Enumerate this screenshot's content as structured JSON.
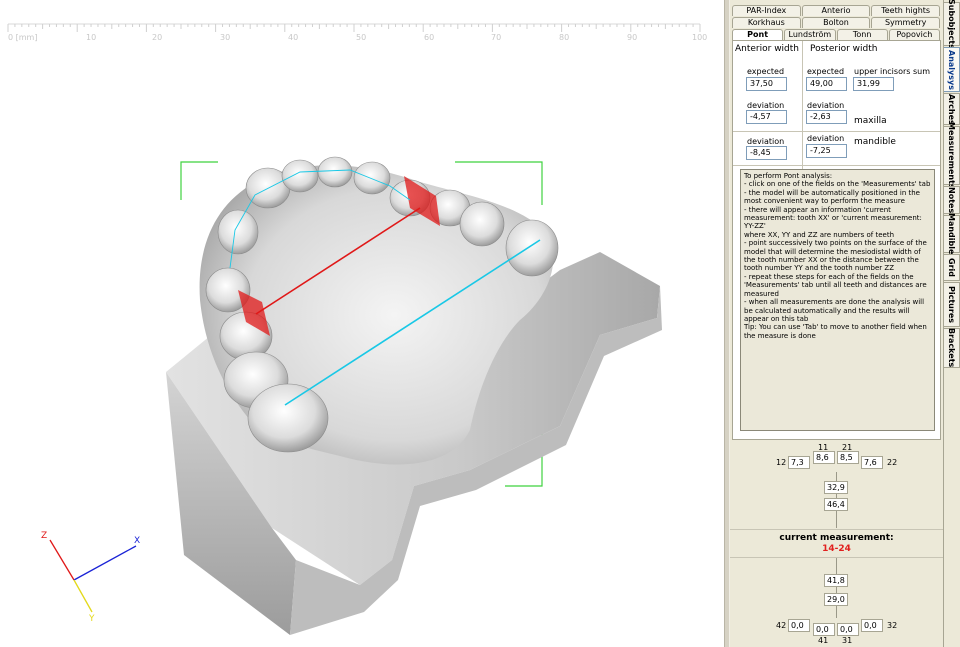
{
  "viewport": {
    "ruler": {
      "labels": [
        "0 [mm]",
        "10",
        "20",
        "30",
        "40",
        "50",
        "60",
        "70",
        "80",
        "90",
        "100"
      ]
    },
    "axes": {
      "z": "Z",
      "x": "X",
      "y": "Y"
    },
    "colors": {
      "measure_red": "#e01818",
      "measure_cyan": "#19c8e6",
      "bracket_green": "#3fd23f"
    }
  },
  "top_tabs": {
    "row1": [
      "PAR-Index",
      "Anterio",
      "Teeth hights"
    ],
    "row2": [
      "Korkhaus",
      "Bolton",
      "Symmetry"
    ],
    "row3": [
      "Pont",
      "Lundström",
      "Tonn",
      "Popovich"
    ]
  },
  "pont": {
    "anterior_width": "Anterior width",
    "posterior_width": "Posterior width",
    "expected_label": "expected",
    "upper_incisors_sum_label": "upper incisors sum",
    "deviation_label": "deviation",
    "maxilla_label": "maxilla",
    "mandible_label": "mandible",
    "anterior_expected": "37,50",
    "posterior_expected": "49,00",
    "upper_incisors_sum": "31,99",
    "anterior_dev_maxilla": "-4,57",
    "posterior_dev_maxilla": "-2,63",
    "anterior_dev_mandible": "-8,45",
    "posterior_dev_mandible": "-7,25"
  },
  "instructions": [
    "To perform Pont analysis:",
    "- click on one of the fields on the 'Measurements' tab",
    "- the model will be automatically positioned in the most convenient way to perform the measure",
    "- there will appear an information 'current measurement: tooth XX' or 'current measurement: YY-ZZ'",
    "where XX, YY and ZZ are numbers of teeth",
    "- point successively two points on the surface of the model that will determine the mesiodistal width of the tooth number XX or the distance between the tooth number YY and the tooth number ZZ",
    "- repeat these steps for each of the fields on the 'Measurements' tab until all teeth and distances are measured",
    "- when all measurements are done the analysis will be calculated automatically and the results will appear on this tab",
    "",
    "Tip: You can use 'Tab' to move to another field when the measure is done"
  ],
  "measurements": {
    "upper": {
      "n11": "11",
      "n21": "21",
      "n12": "12",
      "n22": "22",
      "t12": "7,3",
      "t11": "8,6",
      "t21": "8,5",
      "t22": "7,6",
      "ant": "32,9",
      "post": "46,4"
    },
    "current_title": "current measurement:",
    "current_value": "14-24",
    "lower": {
      "ant": "41,8",
      "post": "29,0",
      "n42": "42",
      "n32": "32",
      "n41": "41",
      "n31": "31",
      "t42": "0,0",
      "t41": "0,0",
      "t31": "0,0",
      "t32": "0,0"
    }
  },
  "side_tabs": [
    "Subobjects",
    "Analysys",
    "Arches",
    "Measurements",
    "Notes",
    "Mandible",
    "Grid",
    "Pictures",
    "Brackets"
  ]
}
